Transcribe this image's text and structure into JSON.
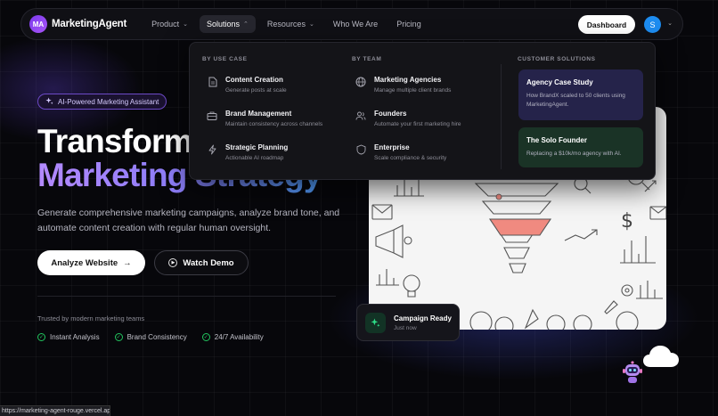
{
  "brand": {
    "logo_initials": "MA",
    "name": "MarketingAgent"
  },
  "nav": {
    "items": [
      {
        "label": "Product",
        "has_dropdown": true,
        "active": false
      },
      {
        "label": "Solutions",
        "has_dropdown": true,
        "active": true
      },
      {
        "label": "Resources",
        "has_dropdown": true,
        "active": false
      },
      {
        "label": "Who We Are",
        "has_dropdown": false,
        "active": false
      },
      {
        "label": "Pricing",
        "has_dropdown": false,
        "active": false
      }
    ],
    "dashboard_label": "Dashboard",
    "avatar_initial": "S"
  },
  "dropdown": {
    "use_case": {
      "heading": "BY USE CASE",
      "items": [
        {
          "title": "Content Creation",
          "desc": "Generate posts at scale",
          "icon": "document-icon"
        },
        {
          "title": "Brand Management",
          "desc": "Maintain consistency across channels",
          "icon": "briefcase-icon"
        },
        {
          "title": "Strategic Planning",
          "desc": "Actionable AI roadmap",
          "icon": "lightning-icon"
        }
      ]
    },
    "team": {
      "heading": "BY TEAM",
      "items": [
        {
          "title": "Marketing Agencies",
          "desc": "Manage multiple client brands",
          "icon": "globe-icon"
        },
        {
          "title": "Founders",
          "desc": "Automate your first marketing hire",
          "icon": "users-icon"
        },
        {
          "title": "Enterprise",
          "desc": "Scale compliance & security",
          "icon": "shield-icon"
        }
      ]
    },
    "customer": {
      "heading": "CUSTOMER SOLUTIONS",
      "cards": [
        {
          "title": "Agency Case Study",
          "desc": "How BrandX scaled to 50 clients using MarketingAgent."
        },
        {
          "title": "The Solo Founder",
          "desc": "Replacing a $10k/mo agency with AI."
        }
      ]
    }
  },
  "hero": {
    "badge": "AI-Powered Marketing Assistant",
    "title_line1": "Transform Your",
    "title_line2": "Marketing Strategy",
    "subtitle": "Generate comprehensive marketing campaigns, analyze brand tone, and automate content creation with regular human oversight.",
    "primary_button": "Analyze Website",
    "secondary_button": "Watch Demo",
    "trusted": "Trusted by modern marketing teams",
    "features": [
      "Instant Analysis",
      "Brand Consistency",
      "24/7 Availability"
    ]
  },
  "campaign_card": {
    "title": "Campaign Ready",
    "subtitle": "Just now"
  },
  "status_bar": {
    "url": "https://marketing-agent-rouge.vercel.app/#"
  },
  "colors": {
    "accent_purple": "#7c3aed",
    "success_green": "#22c55e",
    "funnel_highlight": "#f08a80"
  }
}
